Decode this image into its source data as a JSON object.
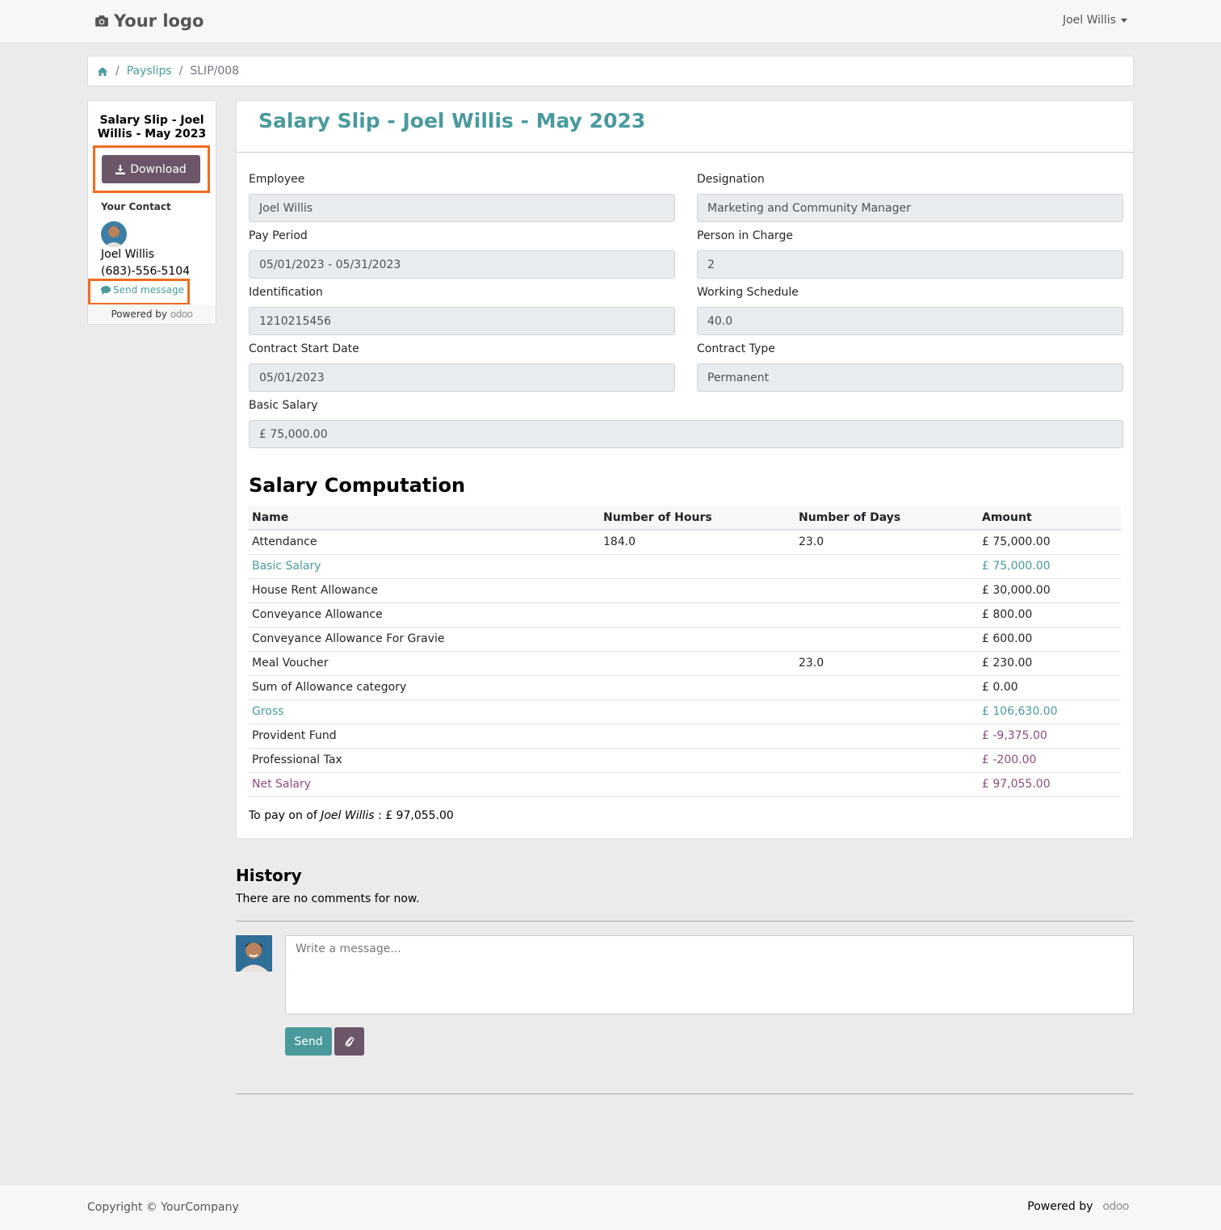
{
  "navbar": {
    "logo_text": "Your logo",
    "user_name": "Joel Willis"
  },
  "breadcrumb": {
    "items": [
      "Payslips",
      "SLIP/008"
    ],
    "separator": "/"
  },
  "sidebar": {
    "title": "Salary Slip - Joel Willis - May 2023",
    "download_label": "Download",
    "contact_label": "Your Contact",
    "contact_name": "Joel Willis",
    "contact_phone": "(683)-556-5104",
    "send_message_label": "Send message",
    "powered_by": "Powered by",
    "odoo_brand": "odoo"
  },
  "payslip": {
    "title": "Salary Slip - Joel Willis - May 2023",
    "fields": {
      "employee": {
        "label": "Employee",
        "value": "Joel Willis"
      },
      "designation": {
        "label": "Designation",
        "value": "Marketing and Community Manager"
      },
      "pay_period": {
        "label": "Pay Period",
        "value": "05/01/2023 - 05/31/2023"
      },
      "person_in_charge": {
        "label": "Person in Charge",
        "value": "2"
      },
      "identification": {
        "label": "Identification",
        "value": "1210215456"
      },
      "working_schedule": {
        "label": "Working Schedule",
        "value": "40.0"
      },
      "contract_start": {
        "label": "Contract Start Date",
        "value": "05/01/2023"
      },
      "contract_type": {
        "label": "Contract Type",
        "value": "Permanent"
      },
      "basic_salary": {
        "label": "Basic Salary",
        "value": "£ 75,000.00"
      }
    },
    "computation": {
      "title": "Salary Computation",
      "columns": [
        "Name",
        "Number of Hours",
        "Number of Days",
        "Amount"
      ],
      "rows": [
        {
          "name": "Attendance",
          "hours": "184.0",
          "days": "23.0",
          "amount": "£ 75,000.00",
          "style": ""
        },
        {
          "name": "Basic Salary",
          "hours": "",
          "days": "",
          "amount": "£ 75,000.00",
          "style": "teal"
        },
        {
          "name": "House Rent Allowance",
          "hours": "",
          "days": "",
          "amount": "£ 30,000.00",
          "style": ""
        },
        {
          "name": "Conveyance Allowance",
          "hours": "",
          "days": "",
          "amount": "£ 800.00",
          "style": ""
        },
        {
          "name": "Conveyance Allowance For Gravie",
          "hours": "",
          "days": "",
          "amount": "£ 600.00",
          "style": ""
        },
        {
          "name": "Meal Voucher",
          "hours": "",
          "days": "23.0",
          "amount": "£ 230.00",
          "style": ""
        },
        {
          "name": "Sum of Allowance category",
          "hours": "",
          "days": "",
          "amount": "£ 0.00",
          "style": ""
        },
        {
          "name": "Gross",
          "hours": "",
          "days": "",
          "amount": "£ 106,630.00",
          "style": "teal"
        },
        {
          "name": "Provident Fund",
          "hours": "",
          "days": "",
          "amount": "£ -9,375.00",
          "style": "neg"
        },
        {
          "name": "Professional Tax",
          "hours": "",
          "days": "",
          "amount": "£ -200.00",
          "style": "neg"
        },
        {
          "name": "Net Salary",
          "hours": "",
          "days": "",
          "amount": "£ 97,055.00",
          "style": "purple"
        }
      ]
    },
    "to_pay": {
      "prefix": "To pay on of ",
      "name": "Joel Willis",
      "suffix": " : £ 97,055.00"
    }
  },
  "history": {
    "title": "History",
    "empty_text": "There are no comments for now.",
    "message_placeholder": "Write a message...",
    "send_label": "Send"
  },
  "footer": {
    "copyright": "Copyright © YourCompany",
    "powered_by": "Powered by",
    "odoo_brand": "odoo"
  },
  "colors": {
    "teal": "#4a9a9c",
    "purple": "#8a4e7a",
    "button_dark": "#6b5569",
    "highlight": "#f26b1d"
  }
}
